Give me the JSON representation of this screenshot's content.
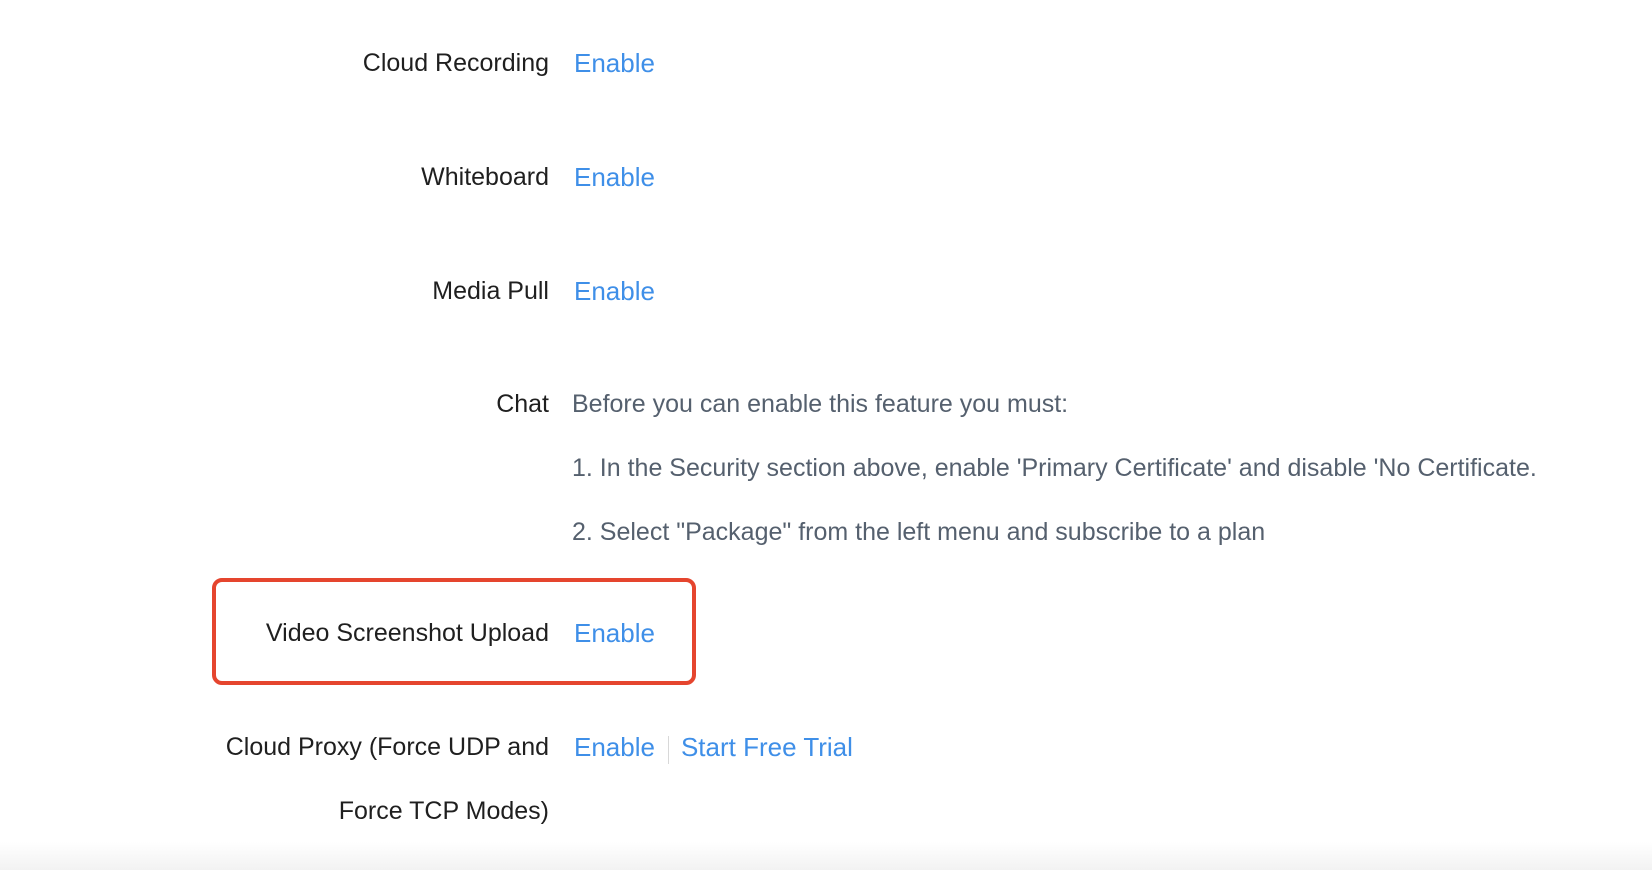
{
  "settings": [
    {
      "label": "Cloud Recording",
      "action": "Enable"
    },
    {
      "label": "Whiteboard",
      "action": "Enable"
    },
    {
      "label": "Media Pull",
      "action": "Enable"
    }
  ],
  "chat": {
    "label": "Chat",
    "notice": "Before you can enable this feature you must:",
    "steps": [
      "1. In the Security section above, enable 'Primary Certificate' and disable 'No Certificate.",
      "2. Select \"Package\" from the left menu and subscribe to a plan"
    ]
  },
  "video_screenshot": {
    "label": "Video Screenshot Upload",
    "action": "Enable"
  },
  "cloud_proxy": {
    "label": "Cloud Proxy (Force UDP and Force TCP Modes)",
    "action": "Enable",
    "trial": "Start Free Trial"
  },
  "colors": {
    "link": "#3f8fe8",
    "highlight": "#e5452e",
    "label": "#1f1f1f",
    "notice": "#55606e"
  }
}
